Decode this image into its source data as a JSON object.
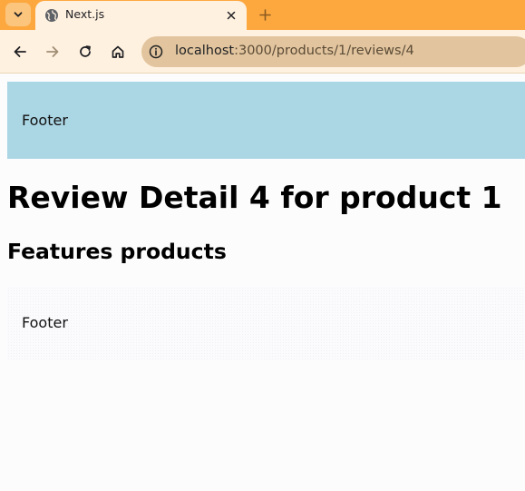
{
  "browser": {
    "tab": {
      "title": "Next.js"
    },
    "address_bar": {
      "host": "localhost",
      "path": ":3000/products/1/reviews/4"
    }
  },
  "page": {
    "footer_top": "Footer",
    "heading": "Review Detail 4 for product 1",
    "subheading": "Features products",
    "footer_bottom": "Footer"
  },
  "colors": {
    "tabstrip": "#fda83f",
    "toolbar": "#fff1e0",
    "omnibox": "#e2c59e",
    "footer_top_bg": "#abd6e4"
  }
}
